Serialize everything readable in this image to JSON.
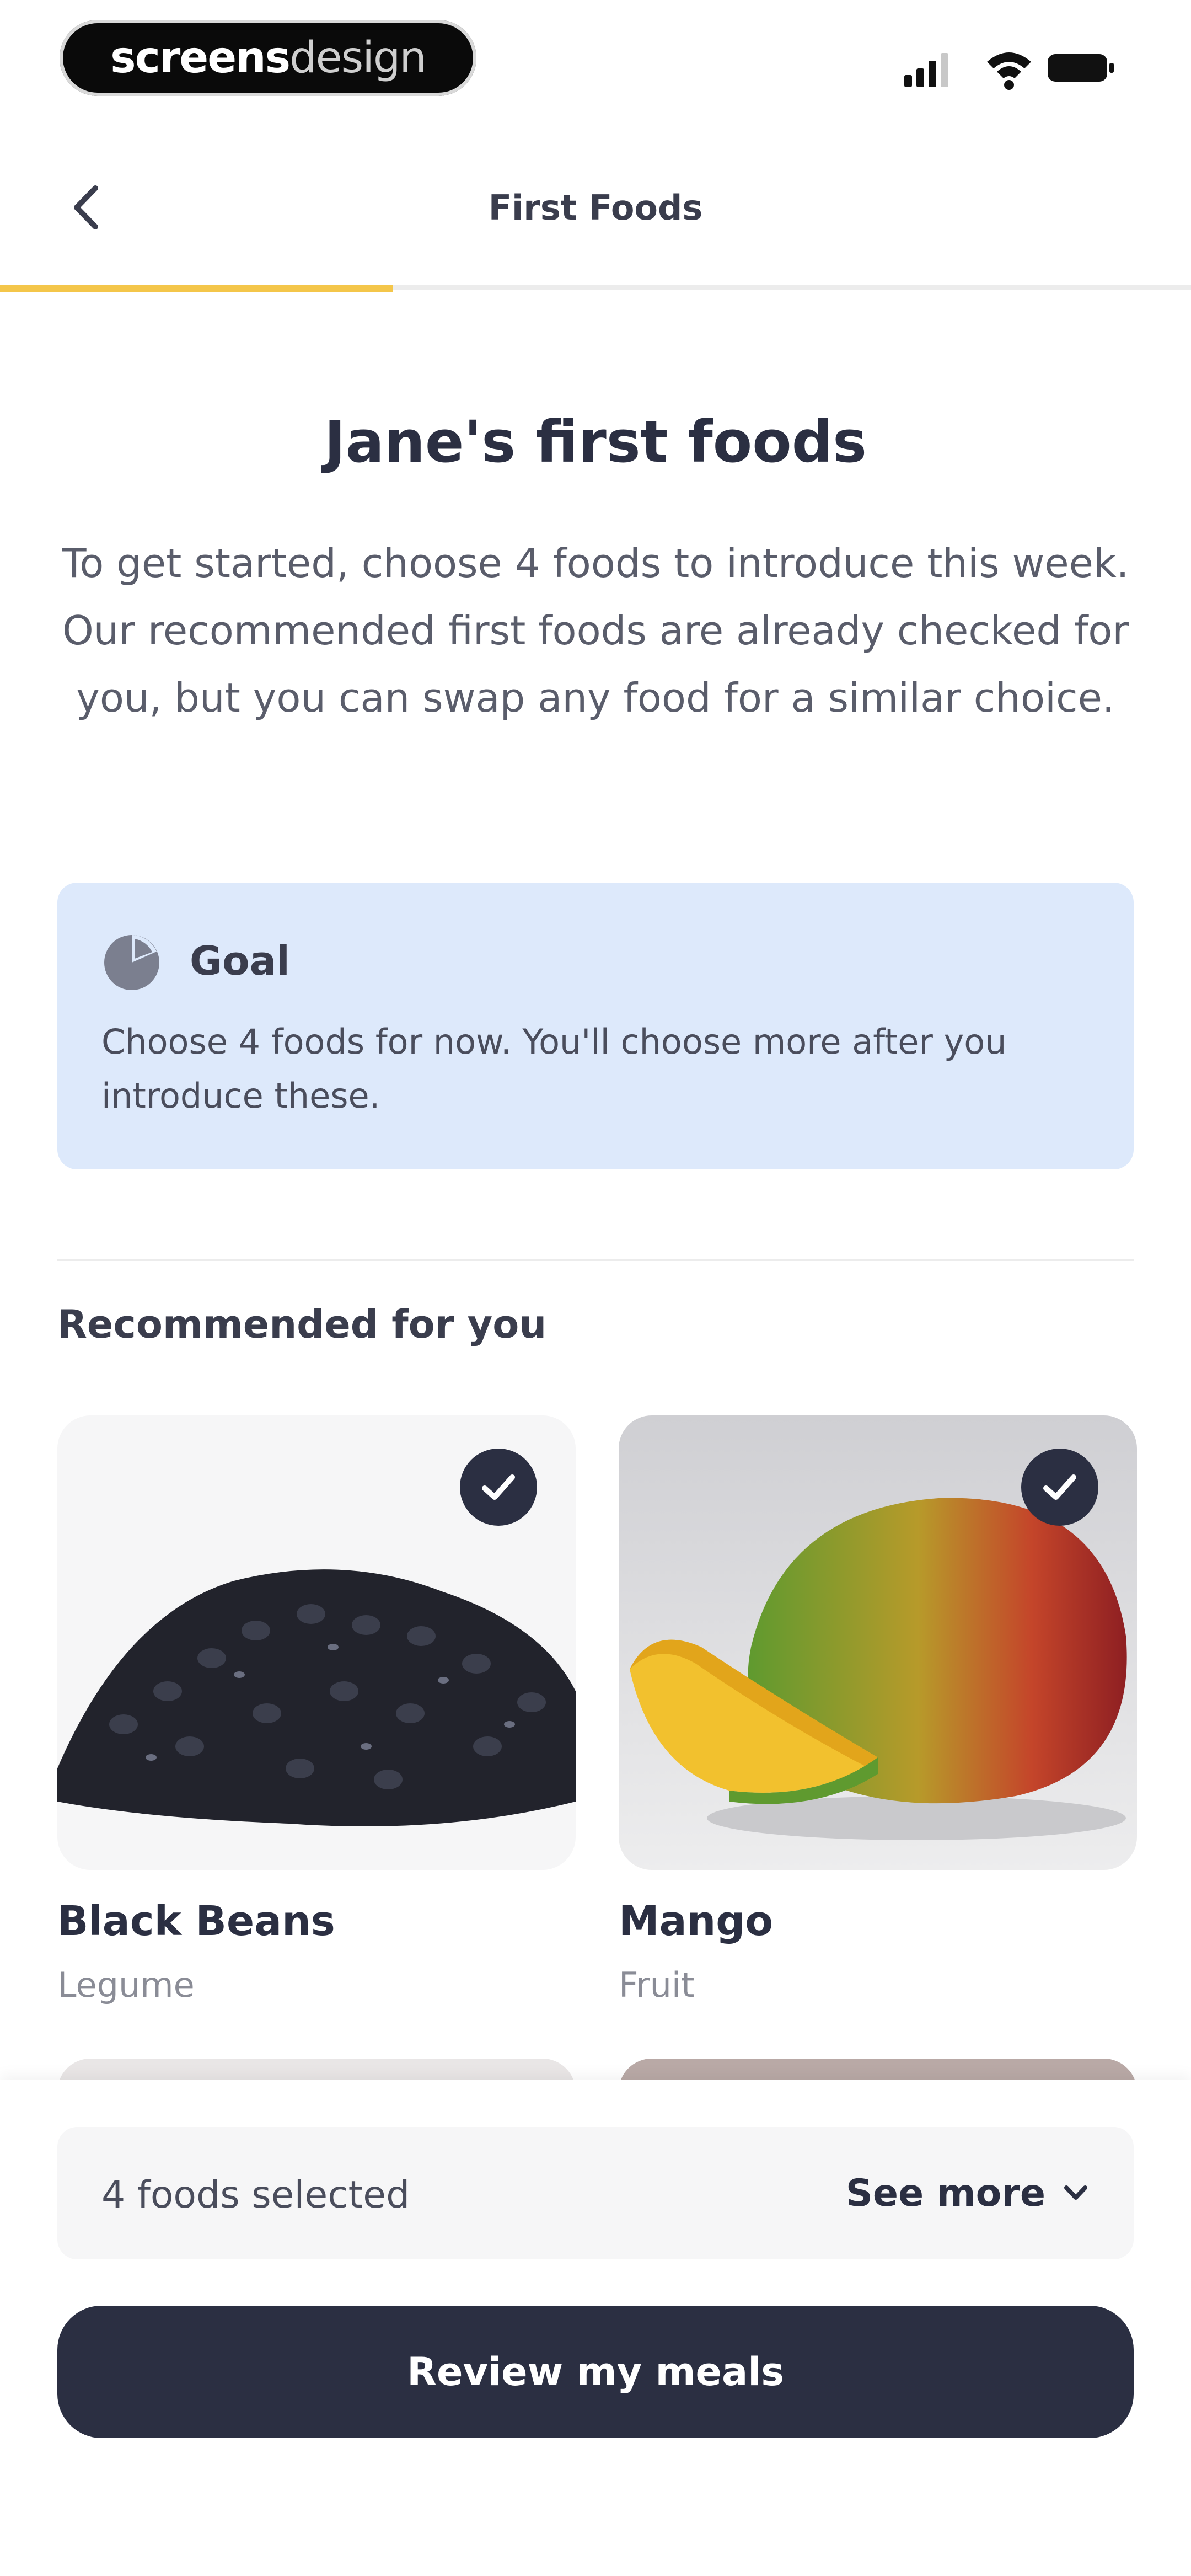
{
  "status_bar": {
    "brand_bold": "screens",
    "brand_light": "design",
    "icons": [
      "signal-icon",
      "wifi-icon",
      "battery-icon"
    ]
  },
  "header": {
    "back_icon": "chevron-left-icon",
    "title": "First Foods",
    "progress": 0.33,
    "progress_color": "#f4c64a"
  },
  "main": {
    "title": "Jane's first foods",
    "intro": "To get started, choose 4 foods to introduce this week. Our recommended first foods are already checked for you, but you can swap any food for a similar choice."
  },
  "goal": {
    "icon": "pie-chart-icon",
    "label": "Goal",
    "text": "Choose 4 foods for now. You'll choose more after you introduce these.",
    "background": "#dde9fb"
  },
  "recommended": {
    "label": "Recommended for you",
    "foods": [
      {
        "name": "Black Beans",
        "category": "Legume",
        "selected": true
      },
      {
        "name": "Mango",
        "category": "Fruit",
        "selected": true
      }
    ]
  },
  "footer": {
    "selected_count": "4 foods selected",
    "see_more": "See more",
    "see_more_icon": "chevron-down-icon",
    "review_button": "Review my meals",
    "button_color": "#2b2f42"
  }
}
